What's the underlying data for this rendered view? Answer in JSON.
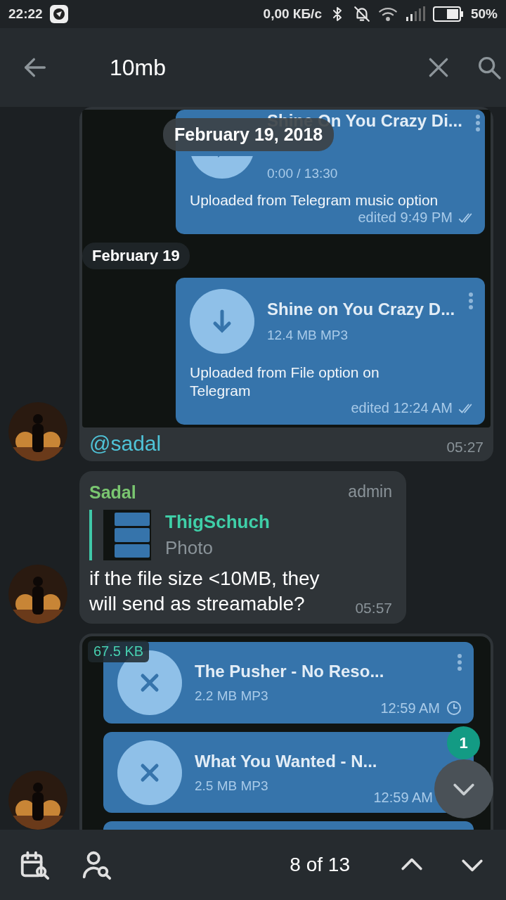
{
  "status_bar": {
    "time": "22:22",
    "net_speed": "0,00 КБ/с",
    "battery": "50%"
  },
  "search_bar": {
    "query": "10mb"
  },
  "floating_date": "February 19, 2018",
  "messages": [
    {
      "avatar": true,
      "caption": "@sadal",
      "time": "05:27",
      "screenshot": [
        {
          "kind": "audio",
          "title": "Shine On You Crazy Di...",
          "subtitle": "0:00 / 13:30",
          "caption": "Uploaded from Telegram music option",
          "time": "edited 9:49 PM",
          "read": true,
          "more_button": true
        },
        {
          "kind": "date",
          "label": "February 19"
        },
        {
          "kind": "file",
          "title": "Shine on You Crazy D...",
          "subtitle": "12.4 MB MP3",
          "caption": "Uploaded from File option on Telegram",
          "time": "edited 12:24 AM",
          "read": true,
          "more_button": true
        }
      ]
    },
    {
      "kind": "text",
      "avatar": true,
      "sender": "Sadal",
      "role": "admin",
      "reply": {
        "author": "ThigSchuch",
        "preview": "Photo"
      },
      "text": "if the file size <10MB, they will send as streamable?",
      "time": "05:57"
    },
    {
      "avatar": true,
      "size_badge": "67.5 KB",
      "screenshot": [
        {
          "kind": "failed_file",
          "title": "The Pusher - No Reso...",
          "subtitle": "2.2 MB MP3",
          "time": "12:59 AM",
          "pending": true,
          "more_button": true
        },
        {
          "kind": "failed_file",
          "title": "What You Wanted - N...",
          "subtitle": "2.5 MB MP3",
          "time": "12:59 AM",
          "more_button": false
        },
        {
          "kind": "partial"
        }
      ]
    }
  ],
  "scroll_button": {
    "badge": "1"
  },
  "bottom_bar": {
    "counter": "8 of 13"
  }
}
